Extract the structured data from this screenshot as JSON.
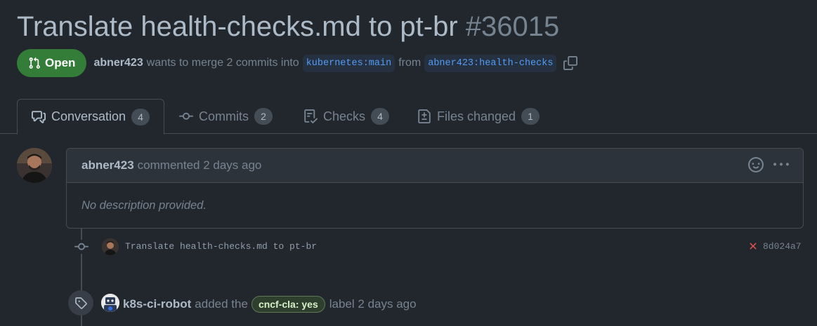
{
  "pr": {
    "title": "Translate health-checks.md to pt-br",
    "number": "#36015",
    "state": "Open",
    "author": "abner423",
    "merge_text": "wants to merge 2 commits into",
    "base_branch": "kubernetes:main",
    "from_text": "from",
    "head_branch": "abner423:health-checks"
  },
  "tabs": [
    {
      "label": "Conversation",
      "count": "4",
      "icon": "comment-discussion-icon"
    },
    {
      "label": "Commits",
      "count": "2",
      "icon": "git-commit-icon"
    },
    {
      "label": "Checks",
      "count": "4",
      "icon": "checklist-icon"
    },
    {
      "label": "Files changed",
      "count": "1",
      "icon": "file-diff-icon"
    }
  ],
  "comment": {
    "author": "abner423",
    "action": "commented 2 days ago",
    "body": "No description provided."
  },
  "commit": {
    "message": "Translate health-checks.md to pt-br",
    "sha": "8d024a7",
    "status": "failure"
  },
  "label_event": {
    "actor": "k8s-ci-robot",
    "action": "added the",
    "label": "cncf-cla: yes",
    "suffix": "label 2 days ago"
  },
  "colors": {
    "background": "#22272e",
    "open_badge": "#347d39",
    "branch_text": "#539bf5",
    "failure": "#e5534b"
  }
}
